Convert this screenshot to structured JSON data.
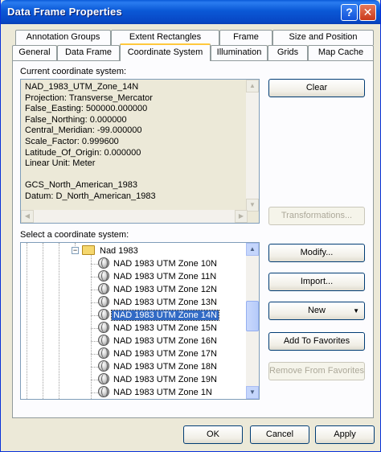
{
  "window": {
    "title": "Data Frame Properties"
  },
  "tabs_back": [
    {
      "label": "Annotation Groups"
    },
    {
      "label": "Extent Rectangles"
    },
    {
      "label": "Frame"
    },
    {
      "label": "Size and Position"
    }
  ],
  "tabs_front": [
    {
      "label": "General"
    },
    {
      "label": "Data Frame"
    },
    {
      "label": "Coordinate System"
    },
    {
      "label": "Illumination"
    },
    {
      "label": "Grids"
    },
    {
      "label": "Map Cache"
    }
  ],
  "current_cs": {
    "label": "Current coordinate system:",
    "text": "NAD_1983_UTM_Zone_14N\nProjection: Transverse_Mercator\nFalse_Easting: 500000.000000\nFalse_Northing: 0.000000\nCentral_Meridian: -99.000000\nScale_Factor: 0.999600\nLatitude_Of_Origin: 0.000000\nLinear Unit: Meter\n\nGCS_North_American_1983\nDatum: D_North_American_1983"
  },
  "buttons": {
    "clear": "Clear",
    "transformations": "Transformations...",
    "modify": "Modify...",
    "import": "Import...",
    "new": "New",
    "add_favorites": "Add To Favorites",
    "remove_favorites": "Remove From Favorites",
    "ok": "OK",
    "cancel": "Cancel",
    "apply": "Apply"
  },
  "select_cs": {
    "label": "Select a coordinate system:",
    "folder": "Nad 1983",
    "items": [
      {
        "label": "NAD 1983 UTM Zone 10N"
      },
      {
        "label": "NAD 1983 UTM Zone 11N"
      },
      {
        "label": "NAD 1983 UTM Zone 12N"
      },
      {
        "label": "NAD 1983 UTM Zone 13N"
      },
      {
        "label": "NAD 1983 UTM Zone 14N",
        "selected": true
      },
      {
        "label": "NAD 1983 UTM Zone 15N"
      },
      {
        "label": "NAD 1983 UTM Zone 16N"
      },
      {
        "label": "NAD 1983 UTM Zone 17N"
      },
      {
        "label": "NAD 1983 UTM Zone 18N"
      },
      {
        "label": "NAD 1983 UTM Zone 19N"
      },
      {
        "label": "NAD 1983 UTM Zone 1N"
      }
    ]
  },
  "colors": {
    "titlebar": "#0a58d6",
    "selection": "#316ac5",
    "dialog_bg": "#ece9d8",
    "active_tab_accent": "#ffc83c"
  }
}
